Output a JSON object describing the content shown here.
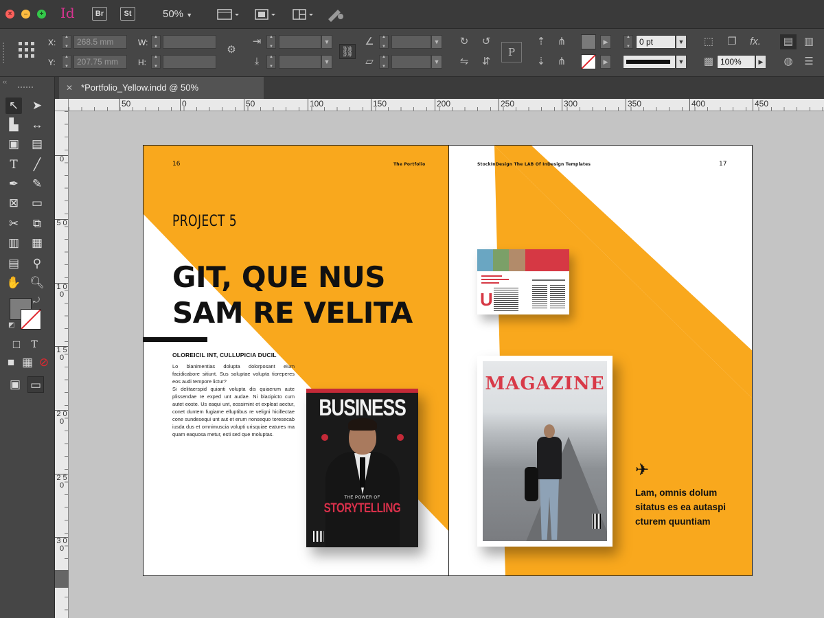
{
  "app": {
    "id_label": "Id",
    "bridge_label": "Br",
    "stock_label": "St",
    "zoom": "50%"
  },
  "control": {
    "x_label": "X:",
    "y_label": "Y:",
    "w_label": "W:",
    "h_label": "H:",
    "x_value": "268.5 mm",
    "y_value": "207.75 mm",
    "stroke_weight": "0 pt",
    "opacity": "100%"
  },
  "document": {
    "tab_title": "*Portfolio_Yellow.indd @ 50%"
  },
  "ruler": {
    "h_ticks": [
      "50",
      "0",
      "50",
      "100",
      "150",
      "200",
      "250",
      "300",
      "350",
      "400",
      "450"
    ],
    "v_ticks": [
      "0",
      "5 0",
      "1 0 0",
      "1 5 0",
      "2 0 0",
      "2 5 0",
      "3 0 0"
    ]
  },
  "spread": {
    "left_page": {
      "folio": "16",
      "running_head": "The Portfolio",
      "project_label": "PROJECT 5",
      "headline_line1": "GIT, QUE NUS",
      "headline_line2": "SAM RE VELITA",
      "subhead": "OLOREICIL INT, CULLUPICIA DUCIL",
      "body": "Lo blanimentias dolupta dolorposant eium facidicabore sitiunt. Sus soluptae volupta tioreperes eos audi tempore lictur?\nSi delitaerspid quianti volupta dis quiaerum aute plissendae re exped unt audae. Ni blacipicto cum autet eoste. Us eaqui unt, eossimint et expleat aectur, conet duntem fugiame elluptibus re veligni hicillectae cone sundesequi unt aut et erum nonsequo toresecab iusda dus et omnimuscia volupti urisquiae eatures ma quam eaquosa metur, esti sed que moluptas."
    },
    "right_page": {
      "folio": "17",
      "running_head": "StockInDesign The LAB Of InDesign Templates",
      "caption": "Lam, omnis dolum sitatus es ea autaspi cturem quuntiam"
    },
    "covers": {
      "business_title": "BUSINESS",
      "business_story_kicker": "THE POWER OF",
      "business_story": "STORYTELLING",
      "magazine_title": "MAGAZINE",
      "brochure_big_letter": "U"
    }
  },
  "colors": {
    "accent_yellow": "#f9a81d",
    "magazine_red": "#d83a48",
    "app_dark": "#3a3a3a"
  }
}
